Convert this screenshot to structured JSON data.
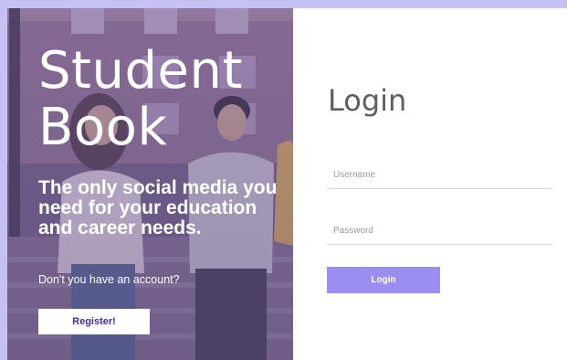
{
  "hero": {
    "title_line1": "Student",
    "title_line2": "Book",
    "tagline": "The only social media you need for your education and career needs.",
    "prompt": "Don't you have an account?",
    "register_label": "Register!"
  },
  "login": {
    "title": "Login",
    "username_placeholder": "Username",
    "password_placeholder": "Password",
    "button_label": "Login"
  },
  "colors": {
    "page_background": "#c5c1f3",
    "login_button": "#9a8ef0",
    "register_text": "#4a2b8a",
    "login_title": "#5d5d66"
  }
}
